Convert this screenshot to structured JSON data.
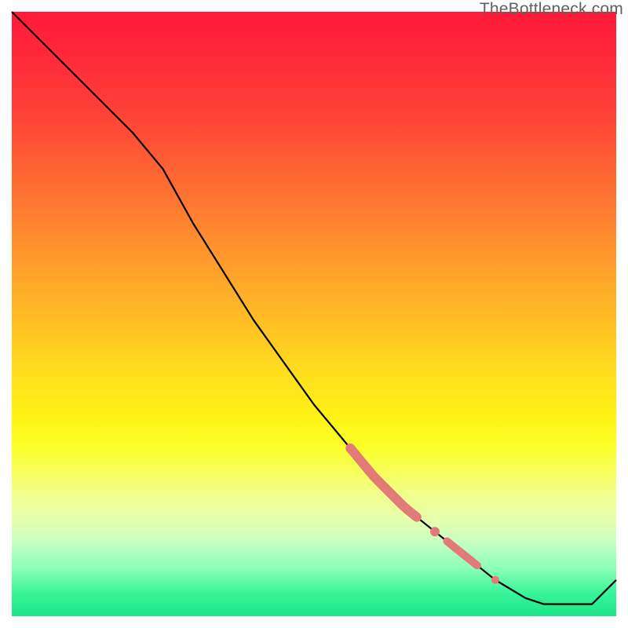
{
  "watermark": "TheBottleneck.com",
  "chart_data": {
    "type": "line",
    "title": "",
    "xlabel": "",
    "ylabel": "",
    "xlim": [
      0,
      100
    ],
    "ylim": [
      0,
      100
    ],
    "grid": false,
    "background": "rainbow-gradient-vertical",
    "series": [
      {
        "name": "curve",
        "color": "#000000",
        "stroke_width": 2.2,
        "x": [
          0,
          5,
          10,
          15,
          20,
          25,
          30,
          35,
          40,
          45,
          50,
          55,
          60,
          65,
          70,
          75,
          80,
          85,
          88,
          92,
          96,
          100
        ],
        "y": [
          100,
          95,
          90,
          85,
          80,
          74,
          65,
          57,
          49,
          42,
          35,
          29,
          23,
          18,
          14,
          10,
          6,
          3,
          2,
          2,
          2,
          6
        ]
      }
    ],
    "annotations": [
      {
        "name": "highlight-segment-main",
        "type": "segment-highlight",
        "color": "#e27a78",
        "width": 12,
        "x_start": 56,
        "x_end": 67
      },
      {
        "name": "highlight-dot-1",
        "type": "point",
        "color": "#e27a78",
        "radius": 6,
        "x": 70
      },
      {
        "name": "highlight-segment-lower",
        "type": "segment-highlight",
        "color": "#e27a78",
        "width": 10,
        "x_start": 72,
        "x_end": 77
      },
      {
        "name": "highlight-dot-2",
        "type": "point",
        "color": "#e27a78",
        "radius": 5,
        "x": 80
      }
    ]
  }
}
